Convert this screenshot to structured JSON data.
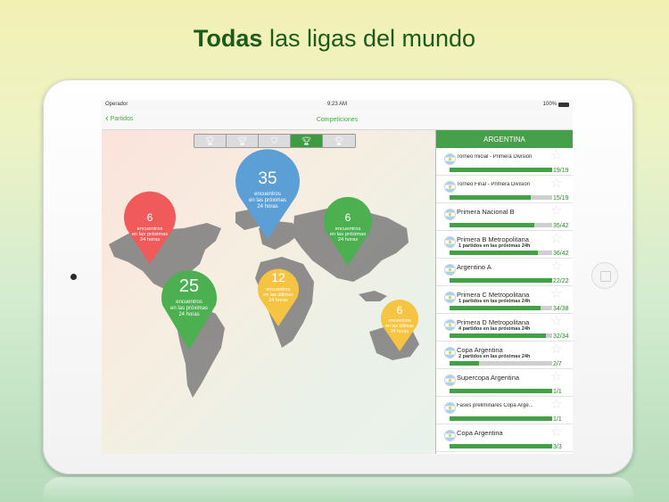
{
  "headline": {
    "bold": "Todas",
    "rest": " las ligas del mundo"
  },
  "status_bar": {
    "carrier": "Operador",
    "time": "9:23 AM",
    "battery": "100%"
  },
  "nav": {
    "back_label": "Partidos",
    "title": "Competiciones"
  },
  "segment_tabs": [
    {
      "icon": "trophy-icon",
      "active": false
    },
    {
      "icon": "trophy-icon",
      "active": false
    },
    {
      "icon": "shield-trophy-icon",
      "active": false
    },
    {
      "icon": "trophy-icon",
      "active": true
    },
    {
      "icon": "trophy-icon",
      "active": false
    }
  ],
  "colors": {
    "green": "#4caf50",
    "blue": "#5b9fd6",
    "red": "#f05a5a",
    "yellow": "#f6c443",
    "accent": "#46a049"
  },
  "pins": [
    {
      "number": "35",
      "lines": [
        "encuentros",
        "en las próximas",
        "24 horas"
      ],
      "color": "#5b9fd6"
    },
    {
      "number": "6",
      "lines": [
        "encuentros",
        "en las próximas",
        "24 horas"
      ],
      "color": "#f05a5a"
    },
    {
      "number": "6",
      "lines": [
        "encuentros",
        "en las próximas",
        "24 horas"
      ],
      "color": "#4caf50"
    },
    {
      "number": "25",
      "lines": [
        "encuentros",
        "en las próximas",
        "24 horas"
      ],
      "color": "#4caf50"
    },
    {
      "number": "12",
      "lines": [
        "encuentros",
        "en las últimas",
        "24 horas"
      ],
      "color": "#f6c443"
    },
    {
      "number": "6",
      "lines": [
        "encuentros",
        "en las últimas",
        "24 horas"
      ],
      "color": "#f6c443"
    }
  ],
  "sidebar": {
    "title": "ARGENTINA",
    "competitions": [
      {
        "name": "Torneo Inicial - Primera División",
        "small": true,
        "sub": "",
        "count": "19/19",
        "progress": 1.0
      },
      {
        "name": "Torneo Final - Primera División",
        "small": true,
        "sub": "",
        "count": "15/19",
        "progress": 0.79
      },
      {
        "name": "Primera Nacional B",
        "small": false,
        "sub": "",
        "count": "35/42",
        "progress": 0.83
      },
      {
        "name": "Primera B Metropolitana",
        "small": false,
        "sub": "1 partidos en las próximas 24h",
        "count": "36/42",
        "progress": 0.86
      },
      {
        "name": "Argentino A",
        "small": false,
        "sub": "",
        "count": "22/22",
        "progress": 1.0
      },
      {
        "name": "Primera C Metropolitana",
        "small": false,
        "sub": "1 partidos en las próximas 24h",
        "count": "34/38",
        "progress": 0.89
      },
      {
        "name": "Primera D Metropolitana",
        "small": false,
        "sub": "4 partidos en las próximas 24h",
        "count": "32/34",
        "progress": 0.94
      },
      {
        "name": "Copa Argentina",
        "small": false,
        "sub": "2 partidos en las próximas 24h",
        "count": "2/7",
        "progress": 0.29
      },
      {
        "name": "Supercopa Argentina",
        "small": false,
        "sub": "",
        "count": "1/1",
        "progress": 1.0
      },
      {
        "name": "Fases preliminares Copa Arge...",
        "small": true,
        "sub": "",
        "count": "1/1",
        "progress": 1.0
      },
      {
        "name": "Copa Argentina",
        "small": false,
        "sub": "",
        "count": "3/3",
        "progress": 1.0
      }
    ]
  }
}
